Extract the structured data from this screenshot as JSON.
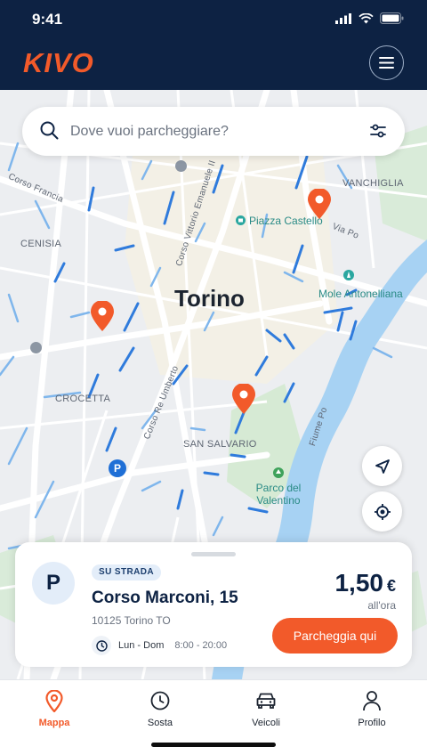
{
  "status_bar": {
    "time": "9:41"
  },
  "header": {
    "logo": "KIVO",
    "menu_icon": "hamburger-menu-icon"
  },
  "search": {
    "placeholder": "Dove vuoi parcheggiare?",
    "search_icon": "search-icon",
    "filter_icon": "filter-sliders-icon"
  },
  "map": {
    "city": "Torino",
    "districts": [
      "CENISIA",
      "CROCETTA",
      "SAN SALVARIO",
      "VANCHIGLIA"
    ],
    "streets": [
      "Corso Francia",
      "Corso Vittorio Emanuele II",
      "Corso Re Umberto",
      "Via Po",
      "Fiume Po"
    ],
    "pois": [
      "Piazza Castello",
      "Mole Antonelliana",
      "Parco del Valentino"
    ],
    "pin_color": "#f25a2a",
    "parking_line_color": "#1f6fd6"
  },
  "map_controls": {
    "navigate_icon": "navigation-arrow-icon",
    "locate_icon": "locate-me-icon"
  },
  "card": {
    "badge": "SU STRADA",
    "address": "Corso Marconi, 15",
    "city": "10125 Torino TO",
    "days": "Lun - Dom",
    "hours": "8:00 - 20:00",
    "price": "1,50",
    "currency": "€",
    "unit": "all'ora",
    "cta": "Parcheggia qui",
    "parking_symbol": "P"
  },
  "tabs": [
    {
      "label": "Mappa",
      "icon": "map-pin-icon",
      "active": true
    },
    {
      "label": "Sosta",
      "icon": "clock-icon",
      "active": false
    },
    {
      "label": "Veicoli",
      "icon": "car-icon",
      "active": false
    },
    {
      "label": "Profilo",
      "icon": "user-icon",
      "active": false
    }
  ],
  "colors": {
    "header": "#0d2243",
    "accent": "#f25a2a",
    "river": "#9ecbf0"
  }
}
